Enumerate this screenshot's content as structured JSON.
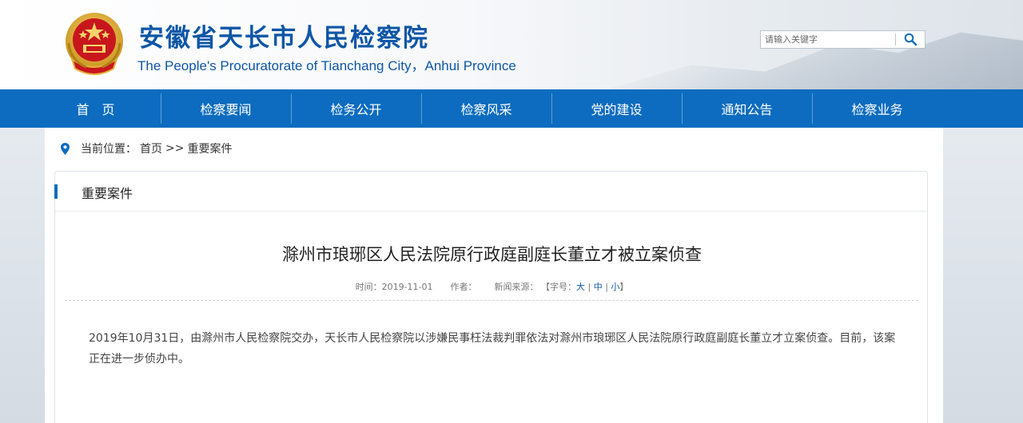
{
  "header": {
    "title": "安徽省天长市人民检察院",
    "subtitle": "The People's Procuratorate of Tianchang City，Anhui Province",
    "emblem_icon": "procuratorate-emblem-icon"
  },
  "search": {
    "placeholder": "请输入关键字",
    "icon": "search-icon"
  },
  "nav": {
    "items": [
      "首　页",
      "检察要闻",
      "检务公开",
      "检察风采",
      "党的建设",
      "通知公告",
      "检察业务"
    ]
  },
  "breadcrumb": {
    "prefix": "当前位置：",
    "home": "首页",
    "separator": ">>",
    "current": "重要案件"
  },
  "section": {
    "title": "重要案件"
  },
  "article": {
    "title": "滁州市琅琊区人民法院原行政庭副庭长董立才被立案侦查",
    "meta": {
      "time": "时间：2019-11-01",
      "author": "作者：",
      "source": "新闻来源：",
      "font_size_prefix": "【字号：",
      "font_large": "大",
      "font_sep1": " | ",
      "font_medium": "中",
      "font_sep2": " | ",
      "font_small": "小",
      "font_size_suffix": "】"
    },
    "paragraph": "2019年10月31日，由滁州市人民检察院交办，天长市人民检察院以涉嫌民事枉法裁判罪依法对滁州市琅琊区人民法院原行政庭副庭长董立才立案侦查。目前，该案正在进一步侦办中。"
  },
  "colors": {
    "primary": "#0d6cbf",
    "title_blue": "#0d56a6",
    "emblem_red": "#c8161d",
    "emblem_gold": "#e3b23c"
  }
}
